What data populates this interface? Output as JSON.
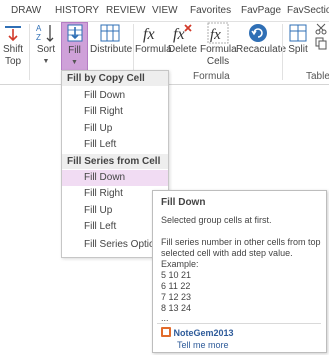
{
  "tabs": [
    "DRAW",
    "HISTORY",
    "REVIEW",
    "VIEW",
    "Favorites",
    "FavPage",
    "FavSection"
  ],
  "ribbon": {
    "shift_top": {
      "line1": "Shift",
      "line2": "Top"
    },
    "sort": "Sort",
    "fill": "Fill",
    "distribute": "Distribute",
    "formula": "Formula",
    "delete": "Delete",
    "formula_cells": {
      "line1": "Formula",
      "line2": "Cells"
    },
    "recaculate": "Recaculate",
    "split": "Split",
    "group_formula": "Formula",
    "group_tables": "Tables"
  },
  "dropdown": {
    "header1": "Fill by Copy Cell",
    "copy_items": [
      "Fill Down",
      "Fill Right",
      "Fill Up",
      "Fill Left"
    ],
    "header2": "Fill Series from Cell",
    "series_items": [
      "Fill Down",
      "Fill Right",
      "Fill Up",
      "Fill Left",
      "Fill Series Options"
    ],
    "selected": "Fill Down"
  },
  "tooltip": {
    "title": "Fill Down",
    "desc": "Selected group cells at first.",
    "body_line1": "Fill series number in other cells from top",
    "body_line2": "selected cell with add step value.",
    "example_label": "Example:",
    "examples": [
      "5 10 21",
      "6 11 22",
      "7 12 23",
      "8 13 24",
      "..."
    ],
    "brand": "NoteGem2013",
    "link": "Tell me more"
  },
  "colors": {
    "accent": "#cfa1d9",
    "selected_item": "#f1dcf3",
    "link": "#2e5b9a",
    "icon_blue": "#2f6fb5",
    "icon_red": "#d23a2a"
  }
}
